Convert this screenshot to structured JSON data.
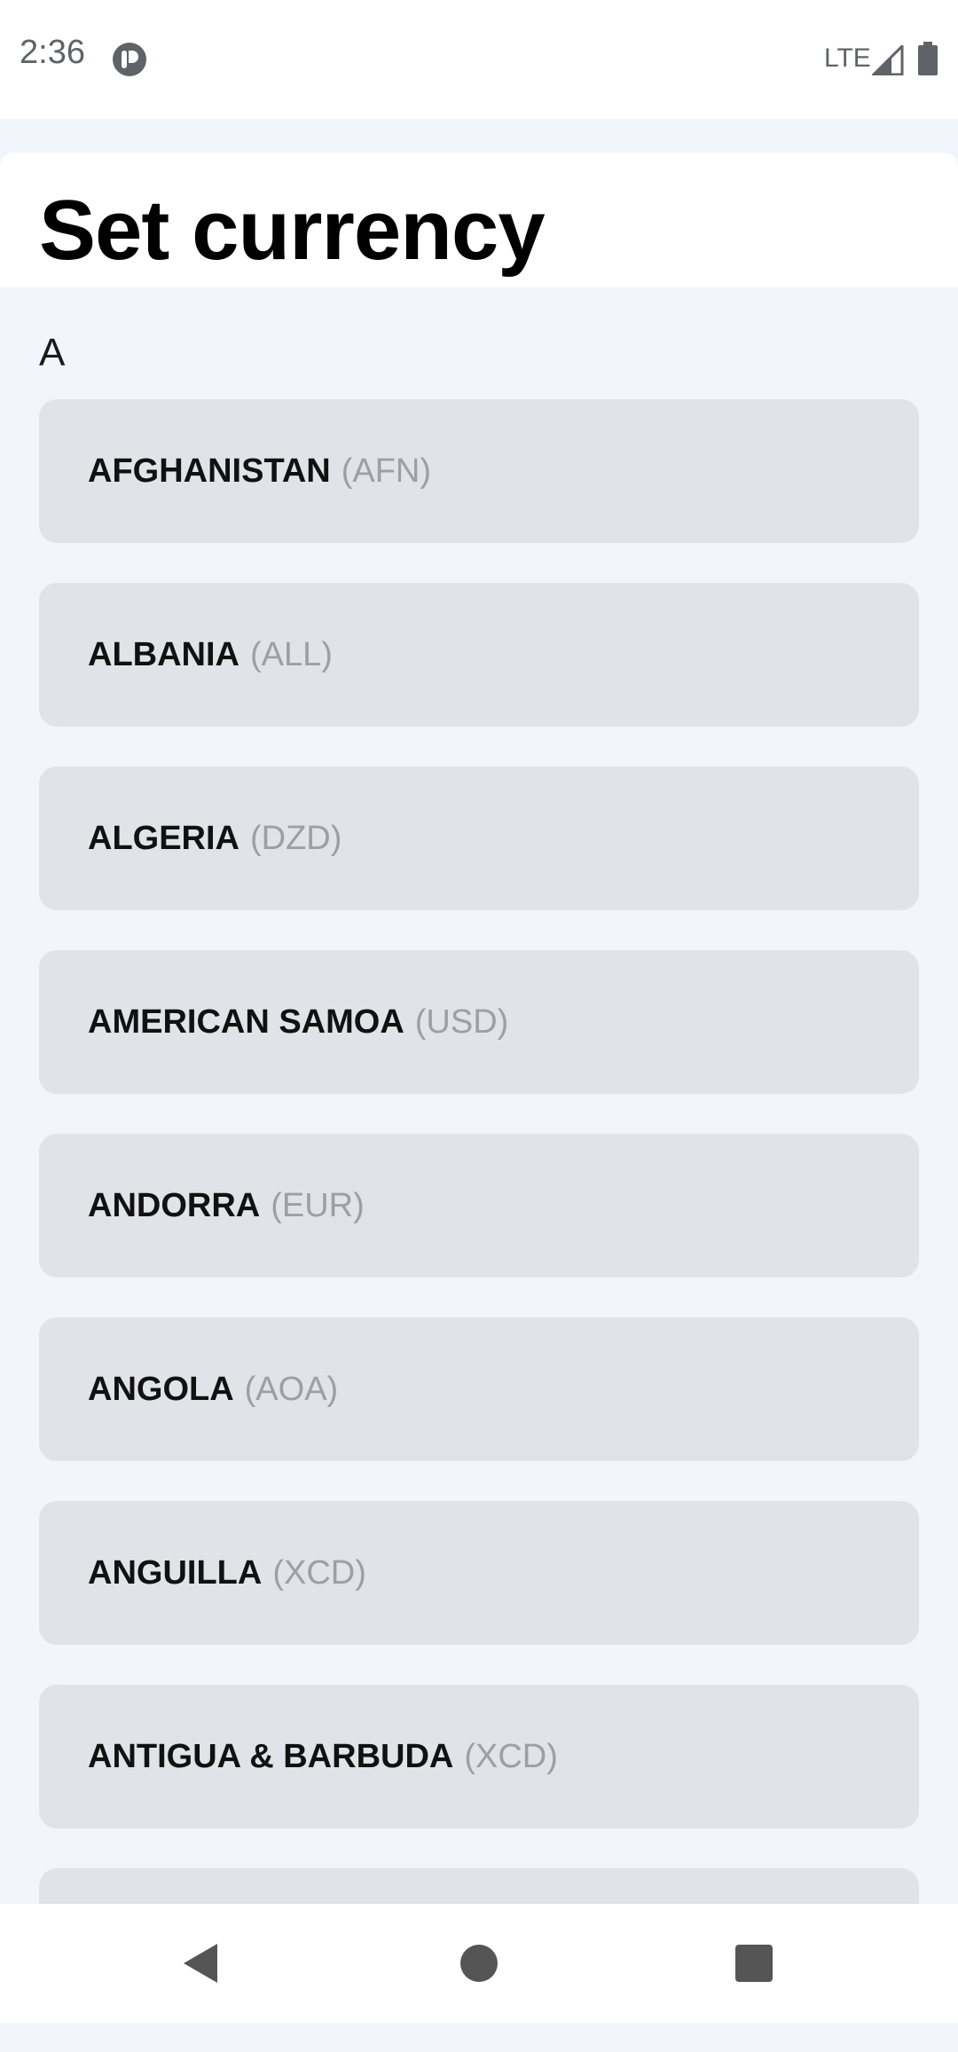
{
  "status_bar": {
    "time": "2:36",
    "network": "LTE",
    "icons": [
      "app-notification-icon",
      "signal-icon",
      "battery-icon"
    ]
  },
  "header": {
    "title": "Set currency"
  },
  "section": {
    "letter": "A"
  },
  "currencies": [
    {
      "country": "AFGHANISTAN",
      "code": "(AFN)"
    },
    {
      "country": "ALBANIA",
      "code": "(ALL)"
    },
    {
      "country": "ALGERIA",
      "code": "(DZD)"
    },
    {
      "country": "AMERICAN SAMOA",
      "code": "(USD)"
    },
    {
      "country": "ANDORRA",
      "code": "(EUR)"
    },
    {
      "country": "ANGOLA",
      "code": "(AOA)"
    },
    {
      "country": "ANGUILLA",
      "code": "(XCD)"
    },
    {
      "country": "ANTIGUA & BARBUDA",
      "code": "(XCD)"
    },
    {
      "country": "",
      "code": ""
    }
  ],
  "nav": {
    "icons": [
      "back-icon",
      "home-icon",
      "recents-icon"
    ]
  },
  "colors": {
    "background": "#f2f5fb",
    "card": "#e1e3e8",
    "code_text": "#9aa0a6",
    "title_text": "#000000"
  }
}
